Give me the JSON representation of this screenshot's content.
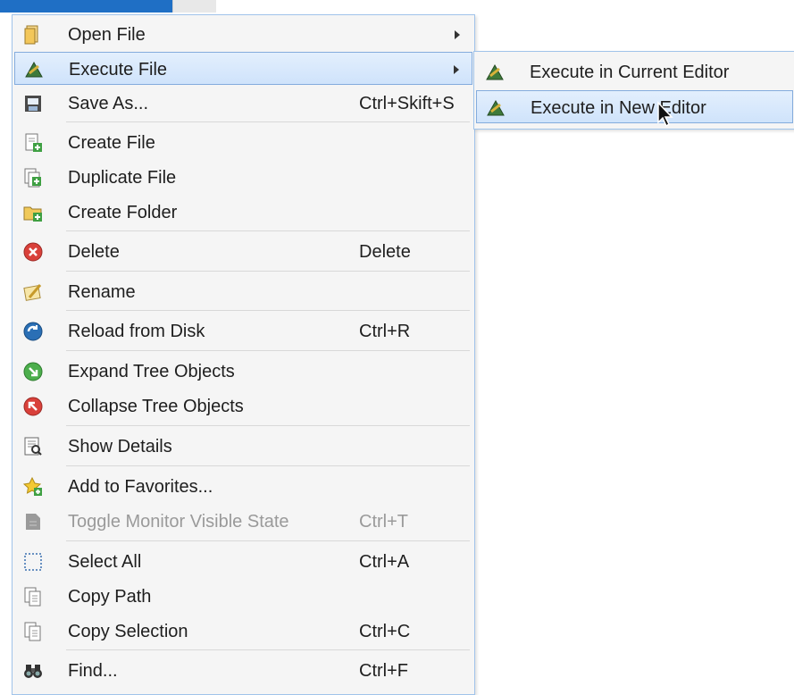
{
  "context_menu": {
    "items": [
      {
        "label": "Open File",
        "shortcut": "",
        "icon": "folder-open-icon"
      },
      {
        "label": "Execute File",
        "shortcut": "",
        "icon": "execute-icon"
      },
      {
        "label": "Save As...",
        "shortcut": "Ctrl+Skift+S",
        "icon": "save-as-icon"
      },
      {
        "label": "Create File",
        "shortcut": "",
        "icon": "create-file-icon"
      },
      {
        "label": "Duplicate File",
        "shortcut": "",
        "icon": "duplicate-file-icon"
      },
      {
        "label": "Create Folder",
        "shortcut": "",
        "icon": "create-folder-icon"
      },
      {
        "label": "Delete",
        "shortcut": "Delete",
        "icon": "delete-icon"
      },
      {
        "label": "Rename",
        "shortcut": "",
        "icon": "rename-icon"
      },
      {
        "label": "Reload from Disk",
        "shortcut": "Ctrl+R",
        "icon": "reload-icon"
      },
      {
        "label": "Expand Tree Objects",
        "shortcut": "",
        "icon": "expand-icon"
      },
      {
        "label": "Collapse Tree Objects",
        "shortcut": "",
        "icon": "collapse-icon"
      },
      {
        "label": "Show Details",
        "shortcut": "",
        "icon": "details-icon"
      },
      {
        "label": "Add to Favorites...",
        "shortcut": "",
        "icon": "favorites-star-icon"
      },
      {
        "label": "Toggle Monitor Visible State",
        "shortcut": "Ctrl+T",
        "icon": "monitor-icon",
        "disabled": true
      },
      {
        "label": "Select All",
        "shortcut": "Ctrl+A",
        "icon": "select-all-icon"
      },
      {
        "label": "Copy Path",
        "shortcut": "",
        "icon": "copy-path-icon"
      },
      {
        "label": "Copy Selection",
        "shortcut": "Ctrl+C",
        "icon": "copy-selection-icon"
      },
      {
        "label": "Find...",
        "shortcut": "Ctrl+F",
        "icon": "binoculars-icon"
      }
    ]
  },
  "submenu": {
    "items": [
      {
        "label": "Execute in Current Editor",
        "icon": "execute-icon"
      },
      {
        "label": "Execute in New Editor",
        "icon": "execute-icon"
      }
    ]
  },
  "colors": {
    "highlight_border": "#84acdd",
    "highlight_fill": "#d9e9fc",
    "menu_bg": "#f5f5f5",
    "disabled_text": "#9a9a9a"
  }
}
